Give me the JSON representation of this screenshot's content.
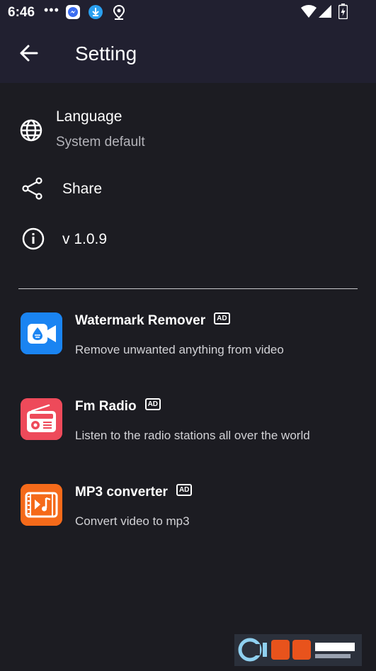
{
  "status_bar": {
    "time": "6:46",
    "dots": "•••",
    "notification_icons": [
      "messenger-icon",
      "download-icon",
      "location-icon"
    ],
    "system_icons": [
      "wifi-icon",
      "cell-signal-icon",
      "battery-charging-icon"
    ]
  },
  "app_bar": {
    "title": "Setting",
    "back_icon": "arrow-left-icon"
  },
  "settings": {
    "language": {
      "title": "Language",
      "value": "System default",
      "icon": "globe-icon"
    },
    "share": {
      "title": "Share",
      "icon": "share-icon"
    },
    "version": {
      "title": "v 1.0.9",
      "icon": "info-icon"
    }
  },
  "ads": [
    {
      "title": "Watermark Remover",
      "badge": "AD",
      "description": "Remove unwanted anything from video",
      "icon": "video-drop-icon",
      "color": "#1a7cf0"
    },
    {
      "title": "Fm Radio",
      "badge": "AD",
      "description": "Listen to the radio stations all over the world",
      "icon": "radio-icon",
      "color": "#f04a58"
    },
    {
      "title": "MP3 converter",
      "badge": "AD",
      "description": "Convert video to mp3",
      "icon": "music-film-icon",
      "color": "#f26a1c"
    }
  ],
  "colors": {
    "background": "#1c1c22",
    "app_bar": "#212030",
    "secondary_text": "#b4b4ba"
  }
}
